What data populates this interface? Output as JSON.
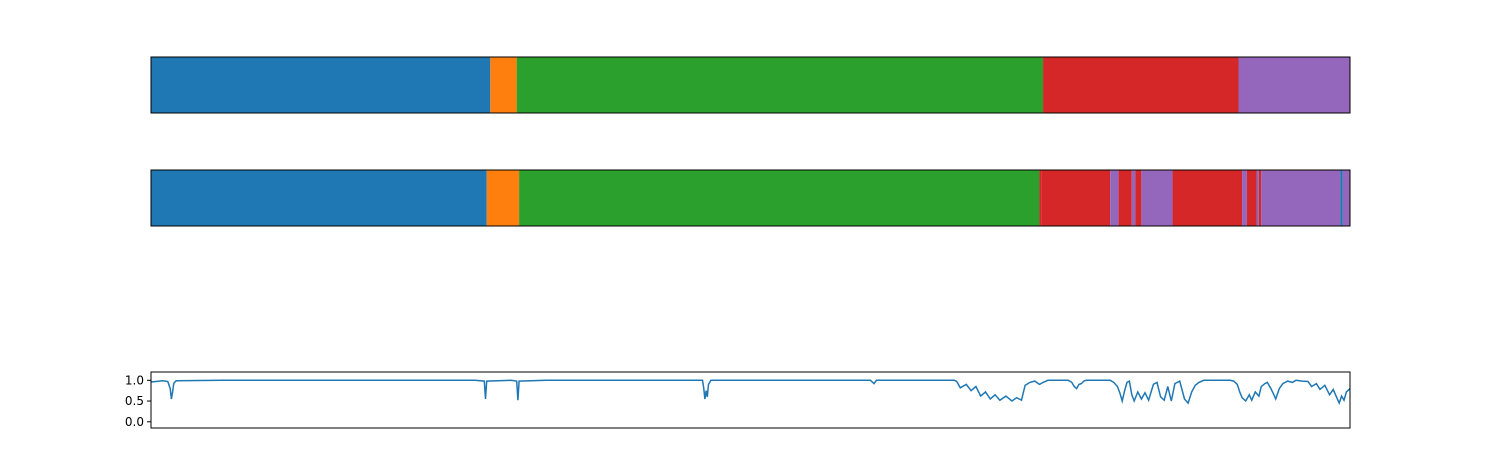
{
  "chart_data": [
    {
      "type": "segmented-bar",
      "panel": "ground-truth",
      "x_range": [
        0,
        1
      ],
      "segments": [
        {
          "start": 0.0,
          "end": 0.283,
          "class": 0
        },
        {
          "start": 0.283,
          "end": 0.305,
          "class": 1
        },
        {
          "start": 0.305,
          "end": 0.744,
          "class": 2
        },
        {
          "start": 0.744,
          "end": 0.907,
          "class": 3
        },
        {
          "start": 0.907,
          "end": 1.0,
          "class": 4
        }
      ]
    },
    {
      "type": "segmented-bar",
      "panel": "prediction",
      "x_range": [
        0,
        1
      ],
      "segments": [
        {
          "start": 0.0,
          "end": 0.28,
          "class": 0
        },
        {
          "start": 0.28,
          "end": 0.307,
          "class": 1
        },
        {
          "start": 0.307,
          "end": 0.741,
          "class": 2
        },
        {
          "start": 0.741,
          "end": 0.743,
          "class": 3
        },
        {
          "start": 0.743,
          "end": 0.8,
          "class": 3
        },
        {
          "start": 0.8,
          "end": 0.807,
          "class": 4
        },
        {
          "start": 0.807,
          "end": 0.818,
          "class": 3
        },
        {
          "start": 0.818,
          "end": 0.821,
          "class": 4
        },
        {
          "start": 0.821,
          "end": 0.826,
          "class": 3
        },
        {
          "start": 0.826,
          "end": 0.852,
          "class": 4
        },
        {
          "start": 0.852,
          "end": 0.91,
          "class": 3
        },
        {
          "start": 0.91,
          "end": 0.914,
          "class": 4
        },
        {
          "start": 0.914,
          "end": 0.922,
          "class": 3
        },
        {
          "start": 0.922,
          "end": 0.924,
          "class": 4
        },
        {
          "start": 0.924,
          "end": 0.926,
          "class": 3
        },
        {
          "start": 0.926,
          "end": 0.992,
          "class": 4
        },
        {
          "start": 0.992,
          "end": 0.994,
          "class": 0
        },
        {
          "start": 0.994,
          "end": 1.0,
          "class": 4
        }
      ]
    },
    {
      "type": "line",
      "panel": "confidence",
      "xlim": [
        0,
        1
      ],
      "ylim": [
        -0.15,
        1.2
      ],
      "yticks": [
        "1.0",
        "0.5",
        "0.0"
      ],
      "ytick_values": [
        1.0,
        0.5,
        0.0
      ],
      "series": [
        {
          "color": "#1f77b4",
          "points": [
            [
              0.0,
              0.96
            ],
            [
              0.01,
              0.99
            ],
            [
              0.014,
              0.97
            ],
            [
              0.016,
              0.8
            ],
            [
              0.017,
              0.55
            ],
            [
              0.018,
              0.72
            ],
            [
              0.019,
              0.93
            ],
            [
              0.021,
              0.99
            ],
            [
              0.06,
              1.0
            ],
            [
              0.27,
              1.0
            ],
            [
              0.278,
              0.98
            ],
            [
              0.279,
              0.55
            ],
            [
              0.28,
              0.98
            ],
            [
              0.3,
              1.0
            ],
            [
              0.305,
              0.98
            ],
            [
              0.306,
              0.52
            ],
            [
              0.307,
              0.98
            ],
            [
              0.33,
              1.0
            ],
            [
              0.46,
              1.0
            ],
            [
              0.461,
              0.82
            ],
            [
              0.462,
              0.55
            ],
            [
              0.463,
              0.75
            ],
            [
              0.464,
              0.6
            ],
            [
              0.465,
              0.9
            ],
            [
              0.467,
              1.0
            ],
            [
              0.6,
              1.0
            ],
            [
              0.603,
              0.92
            ],
            [
              0.605,
              1.0
            ],
            [
              0.67,
              1.0
            ],
            [
              0.672,
              0.97
            ],
            [
              0.675,
              0.82
            ],
            [
              0.68,
              0.9
            ],
            [
              0.684,
              0.75
            ],
            [
              0.688,
              0.85
            ],
            [
              0.692,
              0.62
            ],
            [
              0.696,
              0.72
            ],
            [
              0.7,
              0.55
            ],
            [
              0.704,
              0.65
            ],
            [
              0.708,
              0.52
            ],
            [
              0.713,
              0.62
            ],
            [
              0.718,
              0.5
            ],
            [
              0.722,
              0.58
            ],
            [
              0.726,
              0.52
            ],
            [
              0.729,
              0.88
            ],
            [
              0.733,
              0.95
            ],
            [
              0.737,
              0.98
            ],
            [
              0.741,
              0.9
            ],
            [
              0.744,
              0.95
            ],
            [
              0.748,
              1.0
            ],
            [
              0.765,
              1.0
            ],
            [
              0.768,
              0.95
            ],
            [
              0.77,
              0.85
            ],
            [
              0.772,
              0.8
            ],
            [
              0.774,
              0.9
            ],
            [
              0.776,
              0.92
            ],
            [
              0.778,
              0.98
            ],
            [
              0.78,
              1.0
            ],
            [
              0.8,
              1.0
            ],
            [
              0.803,
              0.95
            ],
            [
              0.806,
              0.85
            ],
            [
              0.808,
              0.7
            ],
            [
              0.81,
              0.5
            ],
            [
              0.812,
              0.75
            ],
            [
              0.814,
              0.95
            ],
            [
              0.816,
              0.98
            ],
            [
              0.818,
              0.65
            ],
            [
              0.82,
              0.5
            ],
            [
              0.823,
              0.72
            ],
            [
              0.826,
              0.55
            ],
            [
              0.829,
              0.7
            ],
            [
              0.832,
              0.52
            ],
            [
              0.836,
              0.9
            ],
            [
              0.839,
              0.95
            ],
            [
              0.842,
              0.6
            ],
            [
              0.845,
              0.52
            ],
            [
              0.848,
              0.85
            ],
            [
              0.851,
              0.5
            ],
            [
              0.854,
              0.92
            ],
            [
              0.858,
              0.98
            ],
            [
              0.862,
              0.55
            ],
            [
              0.865,
              0.45
            ],
            [
              0.868,
              0.72
            ],
            [
              0.871,
              0.88
            ],
            [
              0.874,
              0.95
            ],
            [
              0.878,
              1.0
            ],
            [
              0.9,
              1.0
            ],
            [
              0.903,
              0.98
            ],
            [
              0.906,
              0.9
            ],
            [
              0.908,
              0.72
            ],
            [
              0.91,
              0.58
            ],
            [
              0.913,
              0.5
            ],
            [
              0.916,
              0.65
            ],
            [
              0.918,
              0.52
            ],
            [
              0.921,
              0.72
            ],
            [
              0.924,
              0.62
            ],
            [
              0.926,
              0.85
            ],
            [
              0.929,
              0.92
            ],
            [
              0.931,
              0.95
            ],
            [
              0.934,
              0.8
            ],
            [
              0.936,
              0.68
            ],
            [
              0.938,
              0.55
            ],
            [
              0.941,
              0.8
            ],
            [
              0.944,
              0.92
            ],
            [
              0.948,
              0.98
            ],
            [
              0.952,
              0.95
            ],
            [
              0.955,
              1.0
            ],
            [
              0.96,
              0.98
            ],
            [
              0.965,
              0.97
            ],
            [
              0.968,
              0.85
            ],
            [
              0.972,
              0.92
            ],
            [
              0.975,
              0.78
            ],
            [
              0.979,
              0.88
            ],
            [
              0.983,
              0.65
            ],
            [
              0.986,
              0.78
            ],
            [
              0.989,
              0.58
            ],
            [
              0.991,
              0.45
            ],
            [
              0.993,
              0.62
            ],
            [
              0.995,
              0.52
            ],
            [
              0.997,
              0.72
            ],
            [
              1.0,
              0.8
            ]
          ]
        }
      ]
    }
  ],
  "colors": {
    "classes": [
      "#1f77b4",
      "#ff7f0e",
      "#2ca02c",
      "#d62728",
      "#9467bd"
    ],
    "axes": "#000000",
    "background": "#ffffff"
  }
}
